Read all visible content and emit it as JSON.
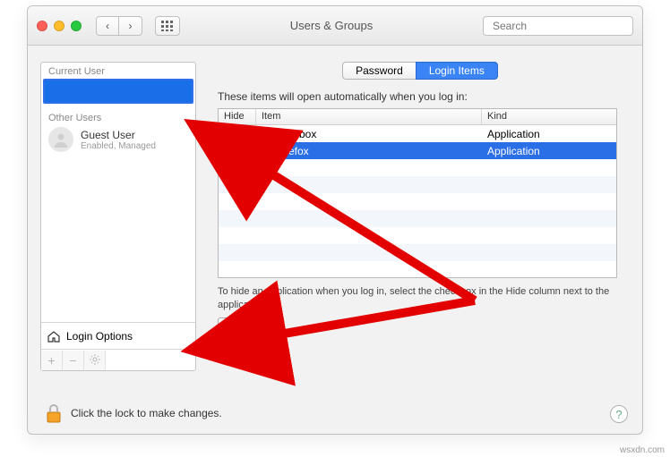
{
  "window_title": "Users & Groups",
  "search": {
    "placeholder": "Search"
  },
  "sidebar": {
    "current_label": "Current User",
    "other_label": "Other Users",
    "guest_name": "Guest User",
    "guest_sub": "Enabled, Managed",
    "login_options": "Login Options"
  },
  "tabs": {
    "password": "Password",
    "login_items": "Login Items"
  },
  "main": {
    "instruction": "These items will open automatically when you log in:",
    "headers": {
      "hide": "Hide",
      "item": "Item",
      "kind": "Kind"
    },
    "items": [
      {
        "name": "Dropbox",
        "kind": "Application",
        "selected": false,
        "icon": "dropbox"
      },
      {
        "name": "Firefox",
        "kind": "Application",
        "selected": true,
        "icon": "firefox"
      }
    ],
    "hint": "To hide an application when you log in, select the checkbox in the Hide column next to the application.",
    "add": "+",
    "remove": "−"
  },
  "footer": {
    "lock_text": "Click the lock to make changes."
  },
  "watermark": "wsxdn.com"
}
